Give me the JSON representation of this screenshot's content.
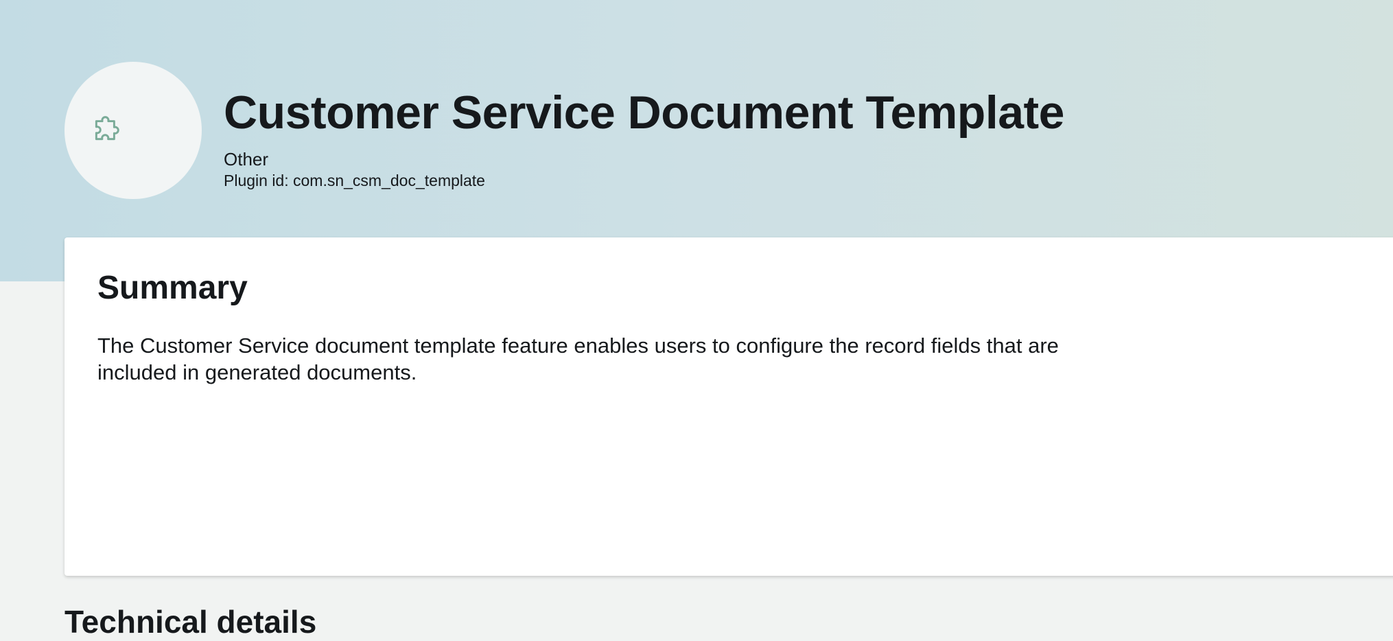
{
  "header": {
    "title": "Customer Service Document Template",
    "category": "Other",
    "plugin_id": "Plugin id: com.sn_csm_doc_template",
    "icon": "puzzle-piece-icon",
    "icon_color": "#7aab98"
  },
  "summary": {
    "title": "Summary",
    "text": "The Customer Service document template feature enables users to configure the record fields that are included in generated documents."
  },
  "technical_details": {
    "title": "Technical details"
  },
  "colors": {
    "hero_gradient_start": "#c3dce4",
    "hero_gradient_end": "#d3e2df",
    "page_background": "#f1f3f2",
    "card_background": "#ffffff",
    "text": "#16191c"
  }
}
